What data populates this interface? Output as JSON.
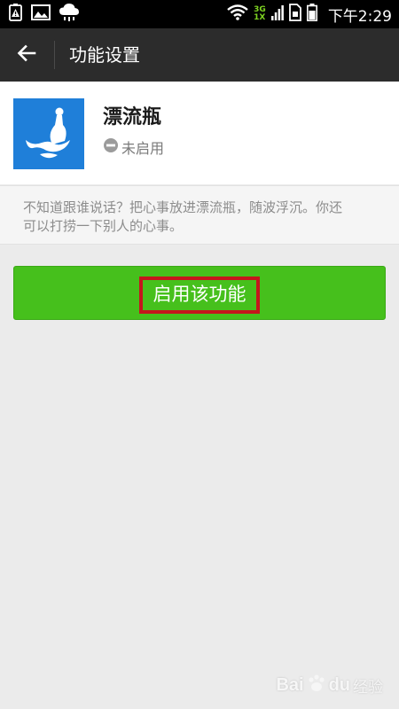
{
  "status_bar": {
    "network_top": "3G",
    "network_bottom": "1X",
    "time": "下午2:29"
  },
  "header": {
    "title": "功能设置"
  },
  "feature": {
    "name": "漂流瓶",
    "status": "未启用",
    "icon_color": "#1f7fd9"
  },
  "description": "不知道跟谁说话？把心事放进漂流瓶，随波浮沉。你还可以打捞一下别人的心事。",
  "enable_button": {
    "label": "启用该功能",
    "color": "#46c01c",
    "highlight_color": "#c4161c"
  },
  "watermark": {
    "brand_a": "Bai",
    "brand_b": "du",
    "suffix": "经验"
  }
}
